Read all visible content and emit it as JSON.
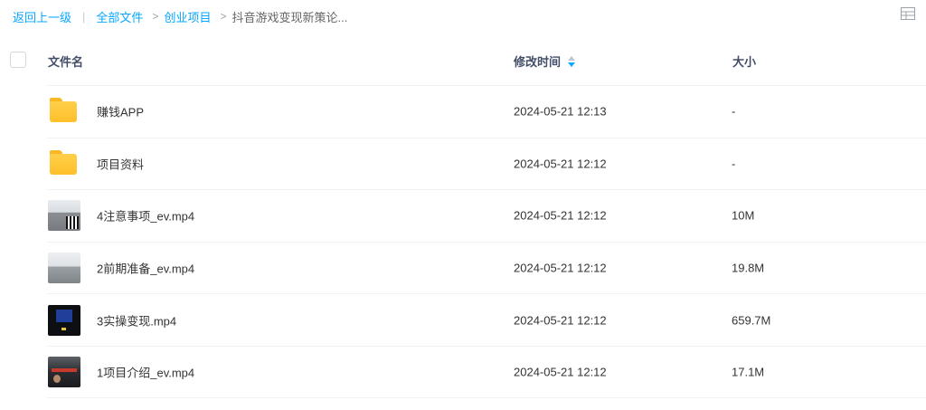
{
  "breadcrumb": {
    "back_label": "返回上一级",
    "separator": "|",
    "arrow": ">",
    "all_files_label": "全部文件",
    "parent_label": "创业项目",
    "current_label": "抖音游戏变现新策论..."
  },
  "view_toggle_icon": "grid-view-icon",
  "table": {
    "headers": {
      "name": "文件名",
      "modified": "修改时间",
      "size": "大小"
    },
    "sort": {
      "column": "modified",
      "direction": "descending"
    },
    "rows": [
      {
        "name": "赚钱APP",
        "modified": "2024-05-21 12:13",
        "size": "-",
        "icon": "folder-icon"
      },
      {
        "name": "项目资料",
        "modified": "2024-05-21 12:12",
        "size": "-",
        "icon": "folder-icon"
      },
      {
        "name": "4注意事项_ev.mp4",
        "modified": "2024-05-21 12:12",
        "size": "10M",
        "icon": "video-thumbnail"
      },
      {
        "name": "2前期准备_ev.mp4",
        "modified": "2024-05-21 12:12",
        "size": "19.8M",
        "icon": "video-thumbnail"
      },
      {
        "name": "3实操变现.mp4",
        "modified": "2024-05-21 12:12",
        "size": "659.7M",
        "icon": "video-thumbnail"
      },
      {
        "name": "1项目介绍_ev.mp4",
        "modified": "2024-05-21 12:12",
        "size": "17.1M",
        "icon": "video-thumbnail"
      }
    ]
  },
  "colors": {
    "accent": "#06a7ff",
    "folder": "#ffc02a",
    "header_text": "#424e67"
  }
}
